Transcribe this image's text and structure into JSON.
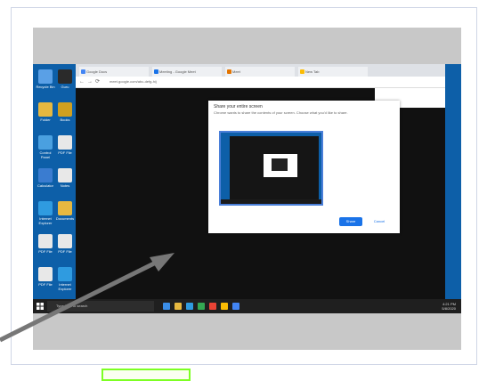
{
  "desktop": {
    "icons": [
      {
        "label": "Recycle Bin",
        "color": "#5aa0e6"
      },
      {
        "label": "Guru",
        "color": "#2a2a2a"
      },
      {
        "label": "Folder",
        "color": "#e6b840"
      },
      {
        "label": "Books",
        "color": "#d0a020"
      },
      {
        "label": "Control Panel",
        "color": "#4aa0e0"
      },
      {
        "label": "PDF File",
        "color": "#e8e8e8"
      },
      {
        "label": "Calculator",
        "color": "#3a7cd0"
      },
      {
        "label": "Notes",
        "color": "#e8e8e8"
      },
      {
        "label": "Internet Explorer",
        "color": "#2f9be0"
      },
      {
        "label": "Documents",
        "color": "#e6b840"
      },
      {
        "label": "PDF File",
        "color": "#e8e8e8"
      },
      {
        "label": "PDF File",
        "color": "#e8e8e8"
      },
      {
        "label": "PDF File",
        "color": "#e8e8e8"
      },
      {
        "label": "Internet Explorer",
        "color": "#2f9be0"
      }
    ]
  },
  "browser": {
    "tabs": [
      {
        "label": "Google Docs",
        "color": "#4285f4"
      },
      {
        "label": "Meeting - Google Meet",
        "color": "#1a73e8"
      },
      {
        "label": "Meet",
        "color": "#e37400"
      },
      {
        "label": "New Tab",
        "color": "#fbbc04"
      }
    ],
    "nav_back": "←",
    "nav_forward": "→",
    "nav_reload": "⟳",
    "url": "meet.google.com/abc-defg-hij"
  },
  "share_dialog": {
    "title": "Share your entire screen",
    "description": "Chrome wants to share the contents of your screen. Choose what you'd like to share.",
    "share_label": "Share",
    "cancel_label": "Cancel"
  },
  "taskbar": {
    "search_placeholder": "Type here to search",
    "tray_time": "4:21 PM",
    "tray_date": "5/8/2020",
    "app_colors": [
      "#3b8ee8",
      "#e6b840",
      "#2f9be0",
      "#34a853",
      "#ea4335",
      "#fbbc04",
      "#4285f4"
    ]
  },
  "colors": {
    "desktop_blue": "#0d5fa8",
    "arrow": "#777777",
    "highlight_border": "#7dff23"
  }
}
